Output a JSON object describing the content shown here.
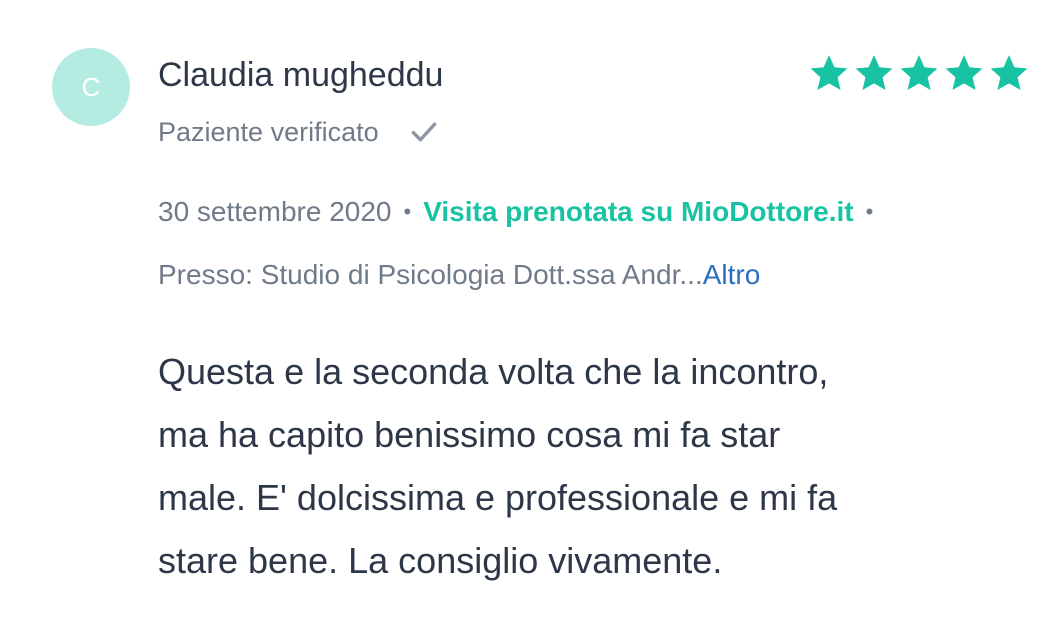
{
  "reviewer": {
    "initial": "C",
    "name": "Claudia mugheddu",
    "verified_label": "Paziente verificato"
  },
  "rating": {
    "value": 5,
    "max": 5,
    "star_color": "#17c3a2",
    "star_icon": "star-icon"
  },
  "meta": {
    "date": "30 settembre 2020",
    "separator": "•",
    "booked_label": "Visita prenotata su MioDottore.it",
    "trailing_separator": "•"
  },
  "location": {
    "text": "Presso: Studio di Psicologia Dott.ssa Andr...",
    "more_label": "Altro"
  },
  "review": {
    "lines": [
      "Questa e la seconda volta che la incontro,",
      "ma ha capito benissimo cosa mi fa star",
      "male. E' dolcissima e professionale e mi fa",
      "stare bene. La consiglio vivamente."
    ]
  },
  "colors": {
    "accent": "#17c3a2",
    "avatar_bg": "#b5ece2",
    "link": "#2c6fbf",
    "muted": "#707b89",
    "text": "#2d3748"
  }
}
